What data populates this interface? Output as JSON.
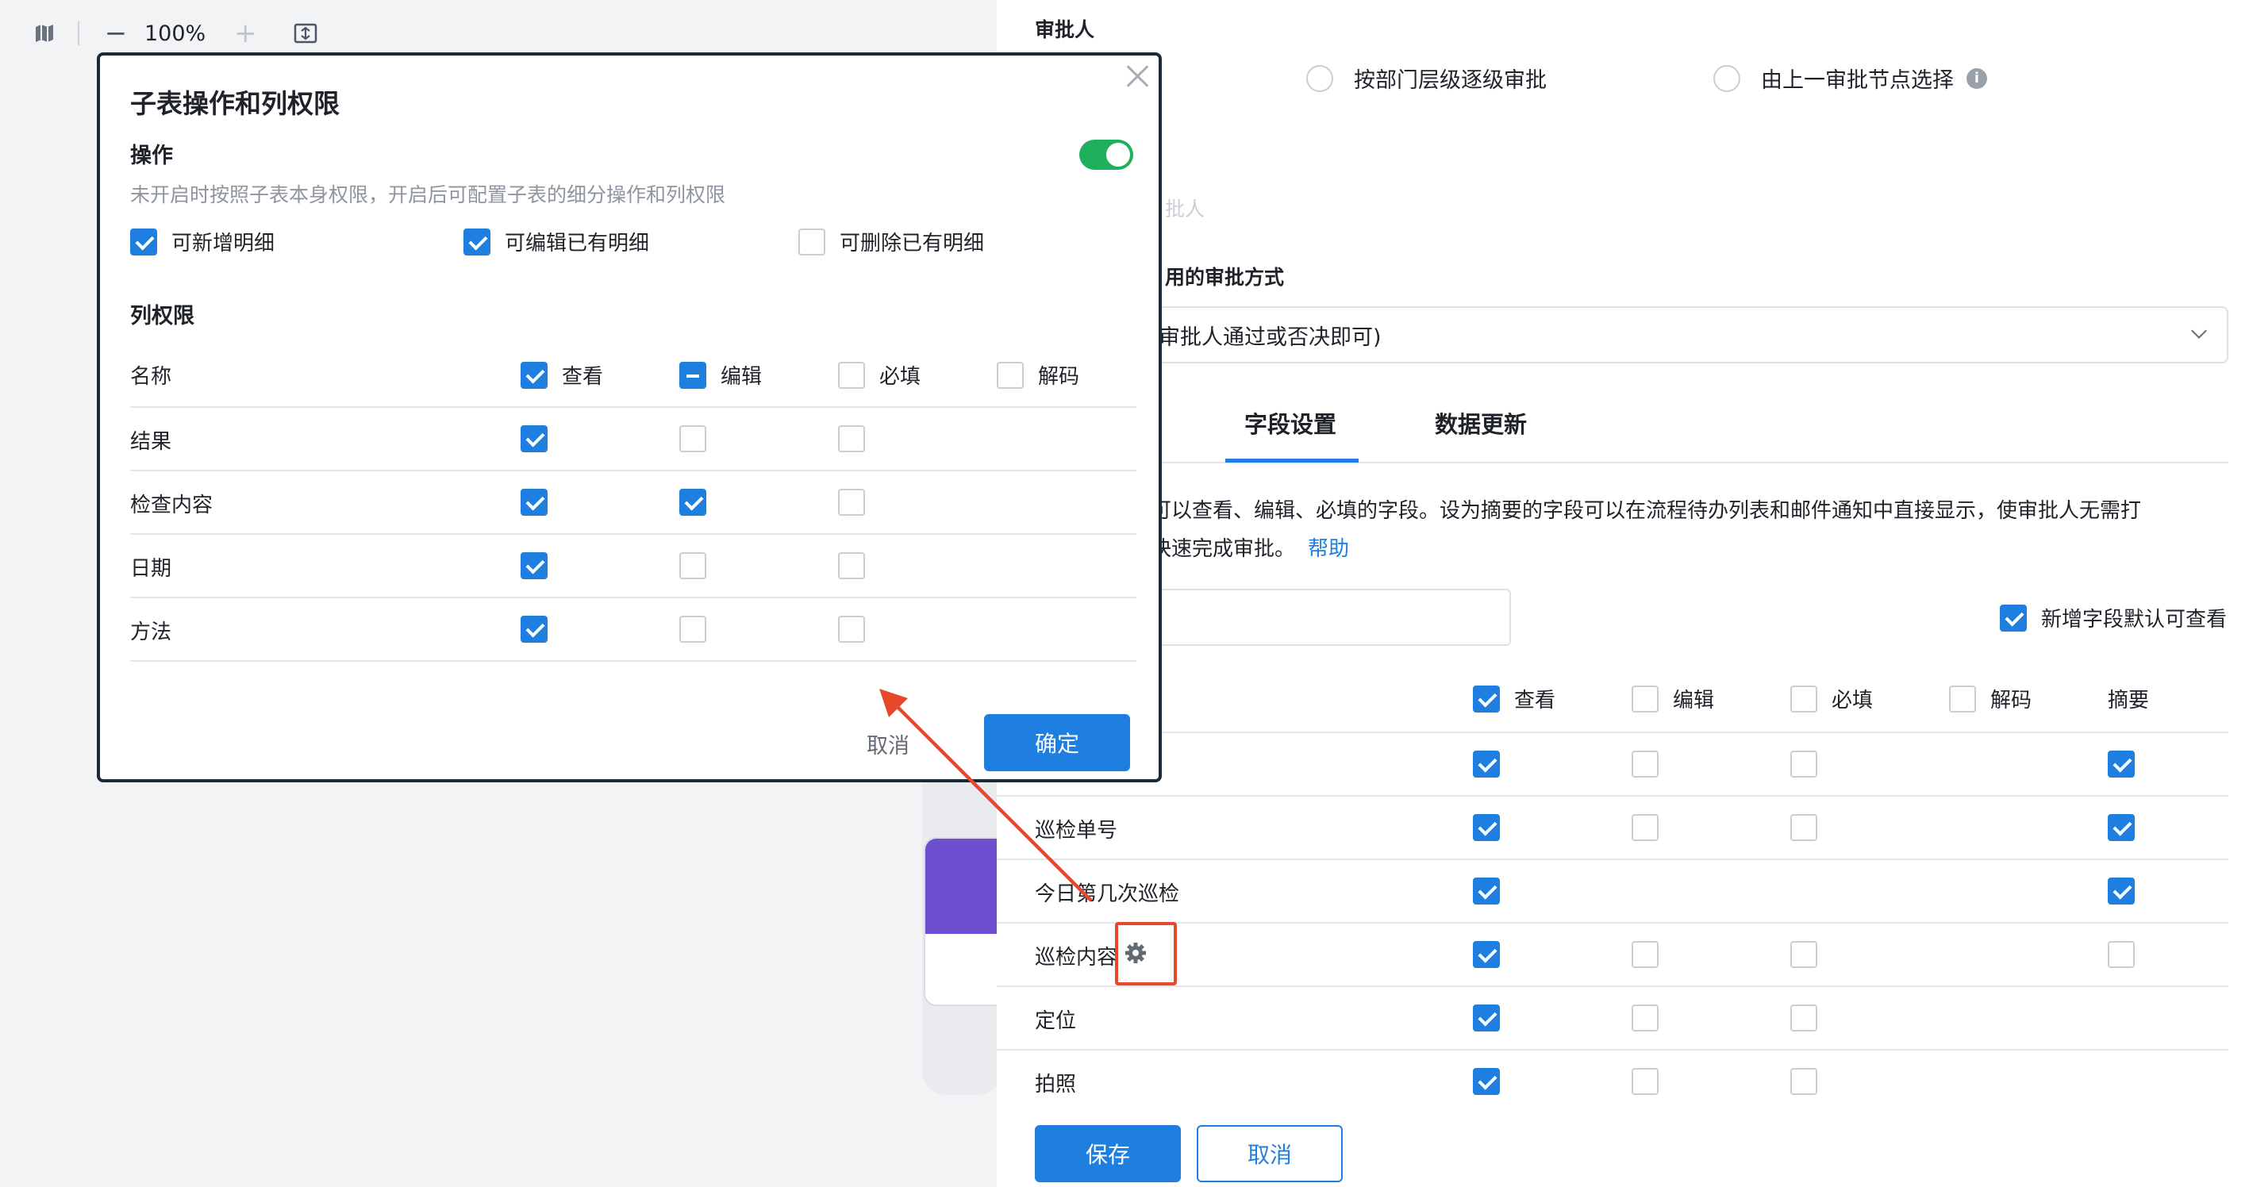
{
  "toolbar": {
    "zoom": "100%",
    "minus": "−",
    "plus": "+"
  },
  "panel": {
    "approver_title": "审批人",
    "radio1": "按部门层级逐级审批",
    "radio2": "由上一审批节点选择",
    "faded_text": "批人",
    "method_title": "用的审批方式",
    "method_select": "审批人通过或否决即可)",
    "tabs": [
      "字段设置",
      "数据更新"
    ],
    "desc_line1": "可以查看、编辑、必填的字段。设为摘要的字段可以在流程待办列表和邮件通知中直接显示，使审批人无需打",
    "desc_line2": "快速完成审批。",
    "help": "帮助",
    "default_view_label": "新增字段默认可查看",
    "columns": [
      "查看",
      "编辑",
      "必填",
      "解码",
      "摘要"
    ],
    "rows": [
      {
        "name": "",
        "view": true,
        "edit": false,
        "req": false,
        "summary": true
      },
      {
        "name": "巡检单号",
        "view": true,
        "edit": false,
        "req": false,
        "summary": true
      },
      {
        "name": "今日第几次巡检",
        "view": true,
        "summary": true
      },
      {
        "name": "巡检内容",
        "view": true,
        "edit": false,
        "req": false,
        "summary": false
      },
      {
        "name": "定位",
        "view": true,
        "edit": false,
        "req": false
      },
      {
        "name": "拍照",
        "view": true,
        "edit": false,
        "req": false
      }
    ],
    "save": "保存",
    "cancel": "取消"
  },
  "modal": {
    "title": "子表操作和列权限",
    "op_title": "操作",
    "op_hint": "未开启时按照子表本身权限，开启后可配置子表的细分操作和列权限",
    "ops": [
      {
        "label": "可新增明细",
        "checked": true
      },
      {
        "label": "可编辑已有明细",
        "checked": true
      },
      {
        "label": "可删除已有明细",
        "checked": false
      }
    ],
    "col_title": "列权限",
    "name_col": "名称",
    "cols": [
      "查看",
      "编辑",
      "必填",
      "解码"
    ],
    "rows": [
      {
        "name": "结果",
        "view": true,
        "edit": false,
        "req": false
      },
      {
        "name": "检查内容",
        "view": true,
        "edit": true,
        "req": false
      },
      {
        "name": "日期",
        "view": true,
        "edit": false,
        "req": false
      },
      {
        "name": "方法",
        "view": true,
        "edit": false,
        "req": false
      }
    ],
    "cancel": "取消",
    "confirm": "确定"
  }
}
